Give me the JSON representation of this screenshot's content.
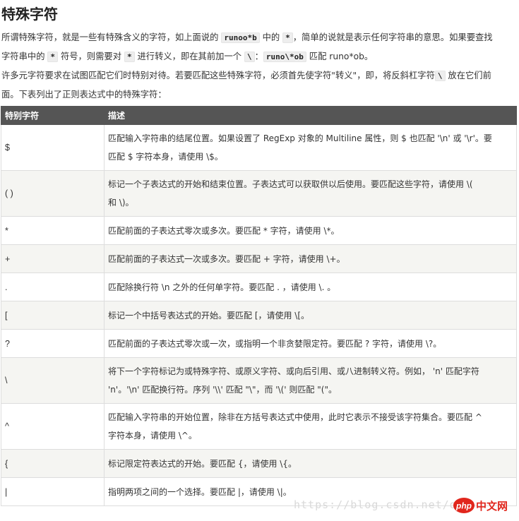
{
  "title": "特殊字符",
  "intro": {
    "p1_line1_a": "所谓特殊字符，就是一些有特殊含义的字符，如上面说的 ",
    "p1_code1": "runoo*b",
    "p1_line1_b": " 中的 ",
    "p1_code2": "*",
    "p1_line1_c": "，简单的说就是表示任何字符串的意思。如果要查找",
    "p1_line2_a": "字符串中的 ",
    "p1_code3": "*",
    "p1_line2_b": " 符号，则需要对 ",
    "p1_code4": "*",
    "p1_line2_c": " 进行转义，即在其前加一个 ",
    "p1_code5": "\\",
    "p1_line2_d": "：",
    "p1_code6": "runo\\*ob",
    "p1_line2_e": " 匹配 runo*ob。",
    "p2_line1_a": "许多元字符要求在试图匹配它们时特别对待。若要匹配这些特殊字符，必须首先使字符\"转义\"，即，将反斜杠字符",
    "p2_code1": "\\",
    "p2_line1_b": " 放在它们前",
    "p2_line2": "面。下表列出了正则表达式中的特殊字符："
  },
  "table": {
    "headers": [
      "特别字符",
      "描述"
    ],
    "rows": [
      {
        "char": "$",
        "desc": [
          "匹配输入字符串的结尾位置。如果设置了 RegExp 对象的 Multiline 属性，则 $ 也匹配 '\\n' 或 '\\r'。要",
          "匹配 $ 字符本身，请使用 \\$。"
        ]
      },
      {
        "char": "( )",
        "desc": [
          "标记一个子表达式的开始和结束位置。子表达式可以获取供以后使用。要匹配这些字符，请使用 \\(",
          "和 \\)。"
        ]
      },
      {
        "char": "*",
        "desc": [
          "匹配前面的子表达式零次或多次。要匹配 * 字符，请使用 \\*。"
        ]
      },
      {
        "char": "+",
        "desc": [
          "匹配前面的子表达式一次或多次。要匹配 + 字符，请使用 \\+。"
        ]
      },
      {
        "char": ".",
        "desc": [
          "匹配除换行符 \\n 之外的任何单字符。要匹配 . ，请使用 \\. 。"
        ]
      },
      {
        "char": "[",
        "desc": [
          "标记一个中括号表达式的开始。要匹配 [，请使用 \\[。"
        ]
      },
      {
        "char": "?",
        "desc": [
          "匹配前面的子表达式零次或一次，或指明一个非贪婪限定符。要匹配 ? 字符，请使用 \\?。"
        ]
      },
      {
        "char": "\\",
        "desc": [
          "将下一个字符标记为或特殊字符、或原义字符、或向后引用、或八进制转义符。例如， 'n' 匹配字符",
          "'n'。'\\n' 匹配换行符。序列 '\\\\' 匹配 \"\\\"，而 '\\(' 则匹配 \"(\"。"
        ]
      },
      {
        "char": "^",
        "desc": [
          "匹配输入字符串的开始位置，除非在方括号表达式中使用，此时它表示不接受该字符集合。要匹配 ^",
          "字符本身，请使用 \\^。"
        ]
      },
      {
        "char": "{",
        "desc": [
          "标记限定符表达式的开始。要匹配 {，请使用 \\{。"
        ]
      },
      {
        "char": "|",
        "desc": [
          "指明两项之间的一个选择。要匹配 |，请使用 \\|。"
        ]
      }
    ]
  },
  "watermark": "https://blog.csdn.net/o",
  "logo": {
    "php_text": "php",
    "cn_text": "中文网",
    "accent_color": "#e1261c"
  },
  "colors": {
    "header_bg": "#555555",
    "row_alt_bg": "#f5f5f2",
    "border": "#dddddd",
    "code_bg": "#eeeeee"
  }
}
